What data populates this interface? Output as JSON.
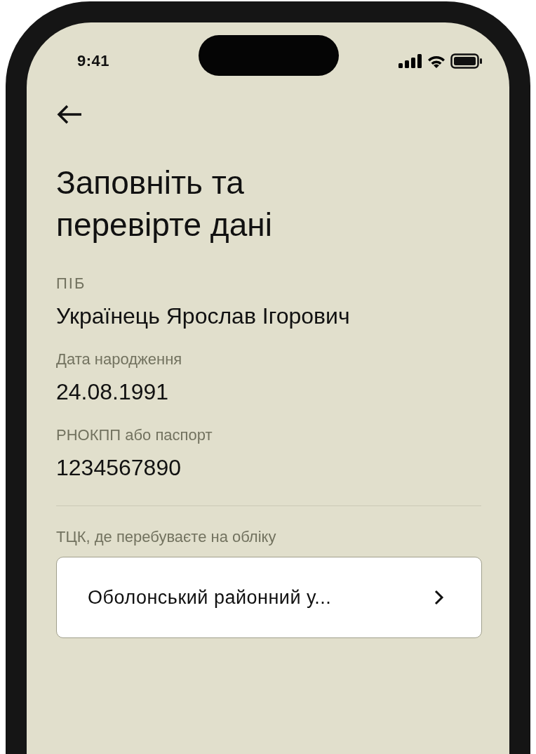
{
  "status_bar": {
    "time": "9:41"
  },
  "title": "Заповніть та перевірте дані",
  "fields": [
    {
      "label": "ПІБ",
      "value": "Українець Ярослав Ігорович"
    },
    {
      "label": "Дата народження",
      "value": "24.08.1991"
    },
    {
      "label": "РНОКПП або паспорт",
      "value": "1234567890"
    }
  ],
  "tck": {
    "label": "ТЦК, де перебуваєте на обліку",
    "value": "Оболонський районний у..."
  }
}
